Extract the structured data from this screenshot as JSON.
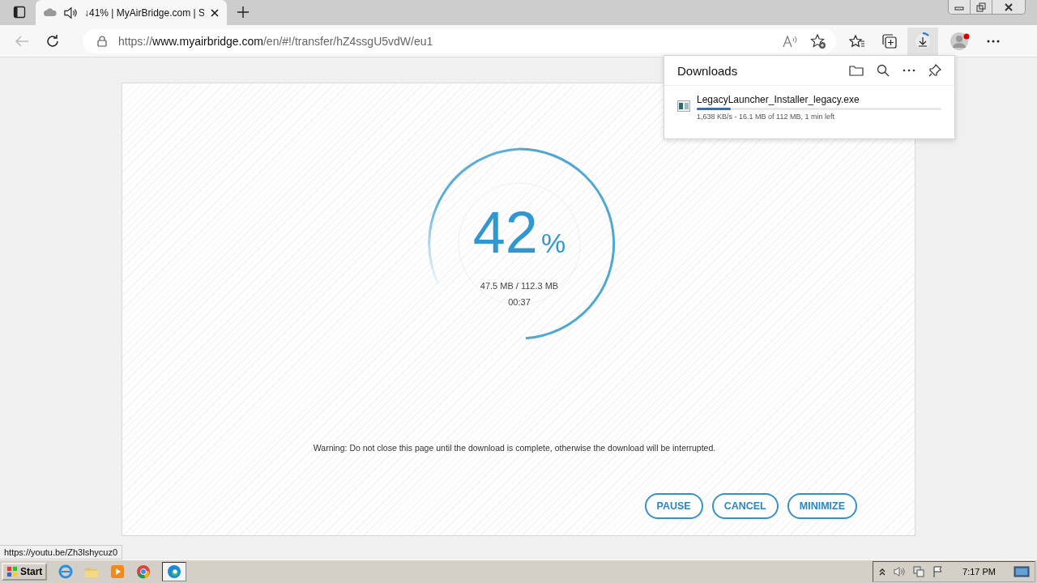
{
  "browser": {
    "tab": {
      "title": "↓41% | MyAirBridge.com | S",
      "selected": true
    },
    "address": {
      "scheme": "https://",
      "host": "www.myairbridge.com",
      "path": "/en/#!/transfer/hZ4ssgU5vdW/eu1"
    }
  },
  "downloads_panel": {
    "title": "Downloads",
    "items": [
      {
        "file": "LegacyLauncher_Installer_legacy.exe",
        "level": 0.14,
        "status": "1,638 KB/s - 16.1 MB of 112 MB, 1 min left"
      }
    ]
  },
  "transfer": {
    "percent": "42",
    "unit": "%",
    "size": "47.5 MB / 112.3 MB",
    "time": "00:37",
    "warning": "Warning: Do not close this page until the download is complete, otherwise the download will be interrupted.",
    "buttons": [
      "PAUSE",
      "CANCEL",
      "MINIMIZE"
    ]
  },
  "status_link": "https://youtu.be/Zh3lshycuz0",
  "taskbar": {
    "start": "Start",
    "clock": "7:17 PM"
  }
}
